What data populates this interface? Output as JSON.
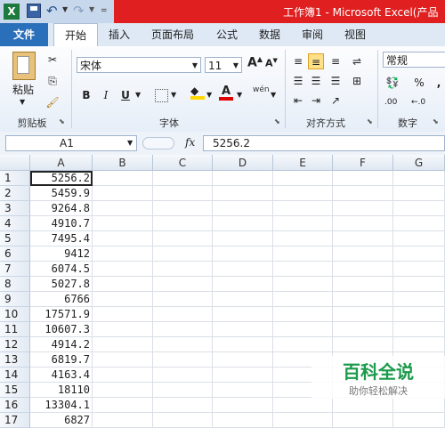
{
  "window": {
    "title": "工作簿1 - Microsoft Excel(产品"
  },
  "tabs": [
    "文件",
    "开始",
    "插入",
    "页面布局",
    "公式",
    "数据",
    "审阅",
    "视图"
  ],
  "ribbon": {
    "clipboard": {
      "label": "剪贴板",
      "paste_label": "粘贴"
    },
    "font": {
      "label": "字体",
      "font_name": "宋体",
      "font_size": "11",
      "bold": "B",
      "italic": "I",
      "underline": "U",
      "grow": "A",
      "shrink": "A",
      "pinyin": "wén"
    },
    "alignment": {
      "label": "对齐方式"
    },
    "number": {
      "label": "数字",
      "format": "常规",
      "percent": "%",
      "comma": ",",
      "inc_decimal": ".00",
      "dec_decimal": "←.0"
    }
  },
  "formula_bar": {
    "name_box": "A1",
    "fx_label": "fx",
    "value": "5256.2"
  },
  "sheet": {
    "columns": [
      "A",
      "B",
      "C",
      "D",
      "E",
      "F",
      "G"
    ],
    "rows": [
      {
        "num": "1",
        "a": "5256.2"
      },
      {
        "num": "2",
        "a": "5459.9"
      },
      {
        "num": "3",
        "a": "9264.8"
      },
      {
        "num": "4",
        "a": "4910.7"
      },
      {
        "num": "5",
        "a": "7495.4"
      },
      {
        "num": "6",
        "a": "9412"
      },
      {
        "num": "7",
        "a": "6074.5"
      },
      {
        "num": "8",
        "a": "5027.8"
      },
      {
        "num": "9",
        "a": "6766"
      },
      {
        "num": "10",
        "a": "17571.9"
      },
      {
        "num": "11",
        "a": "10607.3"
      },
      {
        "num": "12",
        "a": "4914.2"
      },
      {
        "num": "13",
        "a": "6819.7"
      },
      {
        "num": "14",
        "a": "4163.4"
      },
      {
        "num": "15",
        "a": "18110"
      },
      {
        "num": "16",
        "a": "13304.1"
      },
      {
        "num": "17",
        "a": "6827"
      }
    ]
  },
  "watermark": {
    "title": "百科全说",
    "subtitle": "助你轻松解决"
  },
  "colors": {
    "title_red": "#e02020",
    "file_tab": "#2a6fb9",
    "accent_green": "#1c7a3c"
  }
}
